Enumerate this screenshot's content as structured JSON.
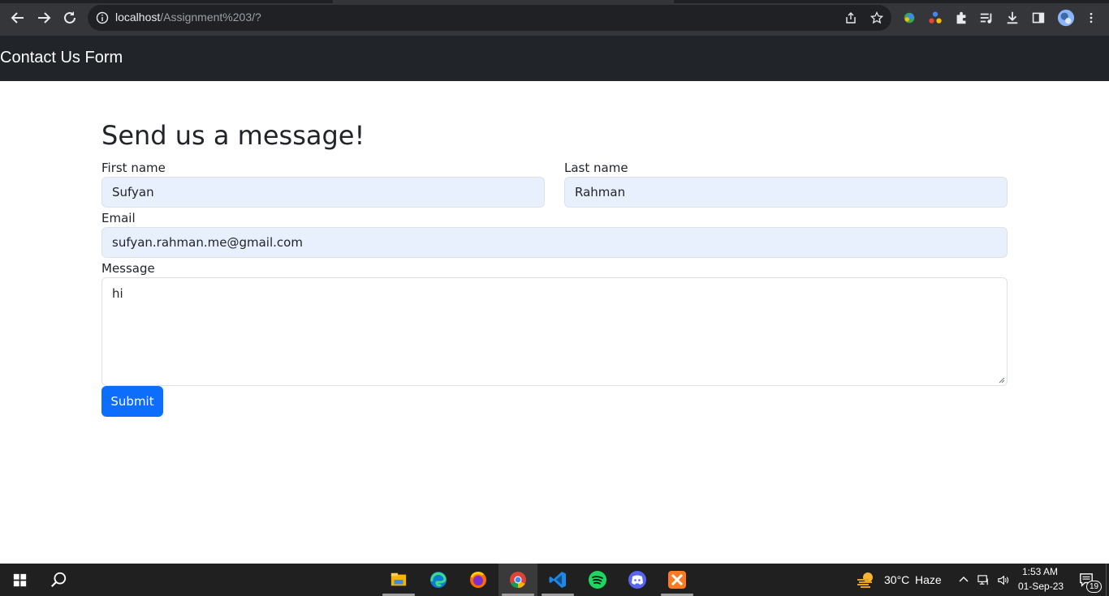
{
  "browser": {
    "url_host": "localhost",
    "url_path": "/Assignment%203/?"
  },
  "navbar": {
    "brand": "Contact Us Form"
  },
  "form": {
    "heading": "Send us a message!",
    "first_name_label": "First name",
    "first_name_value": "Sufyan",
    "last_name_label": "Last name",
    "last_name_value": "Rahman",
    "email_label": "Email",
    "email_value": "sufyan.rahman.me@gmail.com",
    "message_label": "Message",
    "message_value": "hi",
    "submit_label": "Submit"
  },
  "taskbar": {
    "weather_temp": "30°C",
    "weather_desc": "Haze",
    "time": "1:53 AM",
    "date": "01-Sep-23",
    "notification_count": "19",
    "apps": [
      "file-explorer-icon",
      "edge-icon",
      "firefox-icon",
      "chrome-icon",
      "vscode-icon",
      "spotify-icon",
      "discord-icon",
      "xampp-icon"
    ]
  },
  "colors": {
    "navbar_bg": "#212529",
    "submit_bg": "#0d6efd",
    "autofill_bg": "#e8f0fe"
  }
}
